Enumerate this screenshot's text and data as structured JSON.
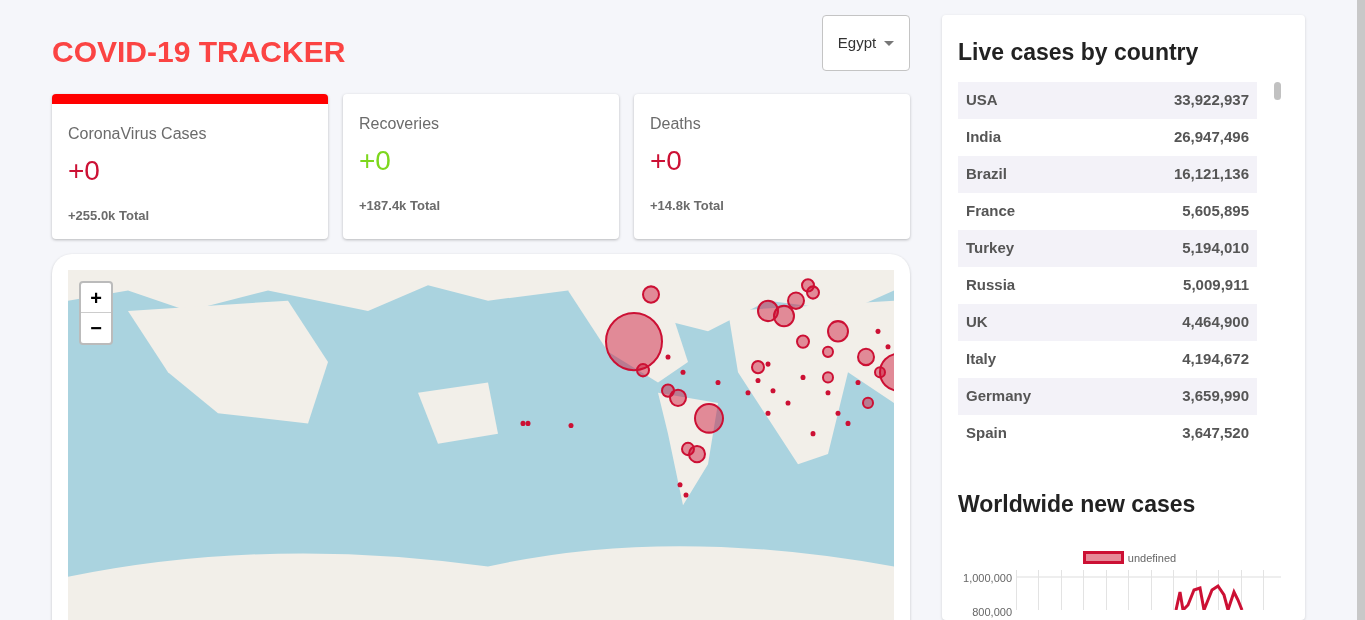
{
  "header": {
    "title": "COVID-19 TRACKER",
    "country_select": {
      "value": "Egypt"
    }
  },
  "stats": [
    {
      "title": "CoronaVirus Cases",
      "value": "+0",
      "total": "+255.0k Total",
      "kind": "cases",
      "selected": true
    },
    {
      "title": "Recoveries",
      "value": "+0",
      "total": "+187.4k Total",
      "kind": "recovered",
      "selected": false
    },
    {
      "title": "Deaths",
      "value": "+0",
      "total": "+14.8k Total",
      "kind": "deaths",
      "selected": false
    }
  ],
  "map": {
    "zoom_in": "+",
    "zoom_out": "−"
  },
  "sidebar": {
    "table_title": "Live cases by country",
    "rows": [
      {
        "country": "USA",
        "cases": "33,922,937"
      },
      {
        "country": "India",
        "cases": "26,947,496"
      },
      {
        "country": "Brazil",
        "cases": "16,121,136"
      },
      {
        "country": "France",
        "cases": "5,605,895"
      },
      {
        "country": "Turkey",
        "cases": "5,194,010"
      },
      {
        "country": "Russia",
        "cases": "5,009,911"
      },
      {
        "country": "UK",
        "cases": "4,464,900"
      },
      {
        "country": "Italy",
        "cases": "4,194,672"
      },
      {
        "country": "Germany",
        "cases": "3,659,990"
      },
      {
        "country": "Spain",
        "cases": "3,647,520"
      }
    ],
    "chart_title": "Worldwide new cases",
    "chart": {
      "legend": "undefined",
      "y_tick_labels": [
        "1,000,000",
        "800,000"
      ]
    }
  }
}
